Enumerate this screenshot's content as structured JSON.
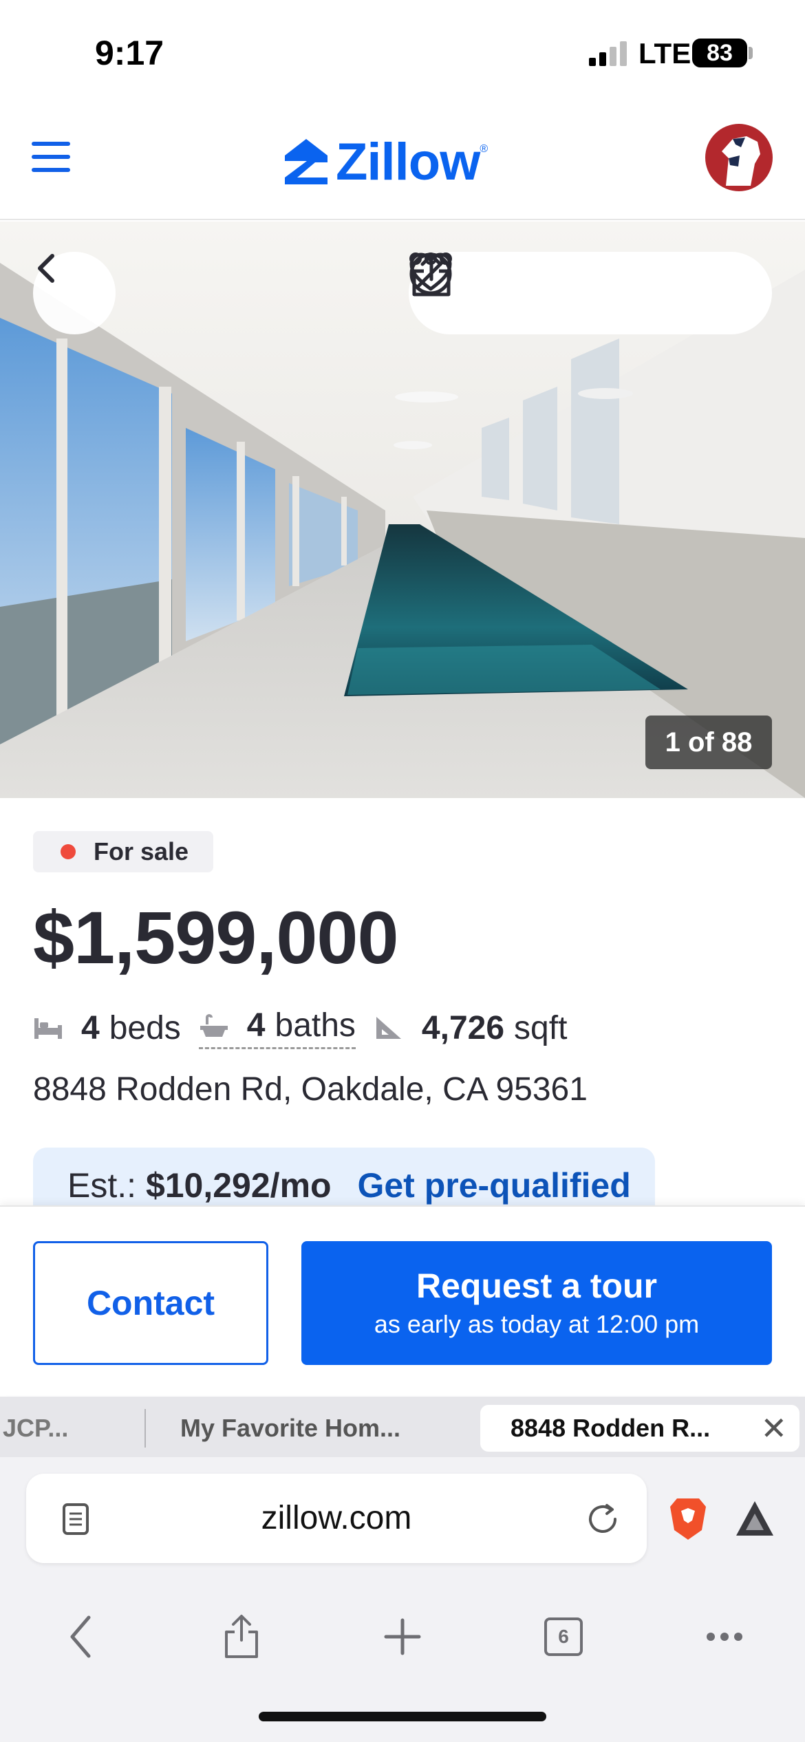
{
  "status_bar": {
    "time": "9:17",
    "network": "LTE",
    "battery": "83"
  },
  "header": {
    "logo_text": "Zillow",
    "logo_mark": "®"
  },
  "hero": {
    "photo_counter": "1 of 88"
  },
  "listing": {
    "status": "For sale",
    "price": "$1,599,000",
    "beds_value": "4",
    "beds_label": "beds",
    "baths_value": "4",
    "baths_label": "baths",
    "sqft_value": "4,726",
    "sqft_label": "sqft",
    "address": "8848 Rodden Rd, Oakdale, CA 95361",
    "estimate_label": "Est.:",
    "estimate_value": "$10,292/mo",
    "prequalify_link": "Get pre-qualified"
  },
  "cta": {
    "contact_label": "Contact",
    "tour_label": "Request a tour",
    "tour_sublabel": "as early as today at 12:00 pm"
  },
  "browser": {
    "tabs": [
      {
        "title": "JCP..."
      },
      {
        "title": "My Favorite Hom..."
      },
      {
        "title": "8848 Rodden R..."
      }
    ],
    "tab_close": "✕",
    "url": "zillow.com",
    "tab_count": "6"
  },
  "colors": {
    "brand_blue": "#0a63ef",
    "status_red": "#ef4a3c",
    "estimate_bg": "#e6f0fd"
  }
}
